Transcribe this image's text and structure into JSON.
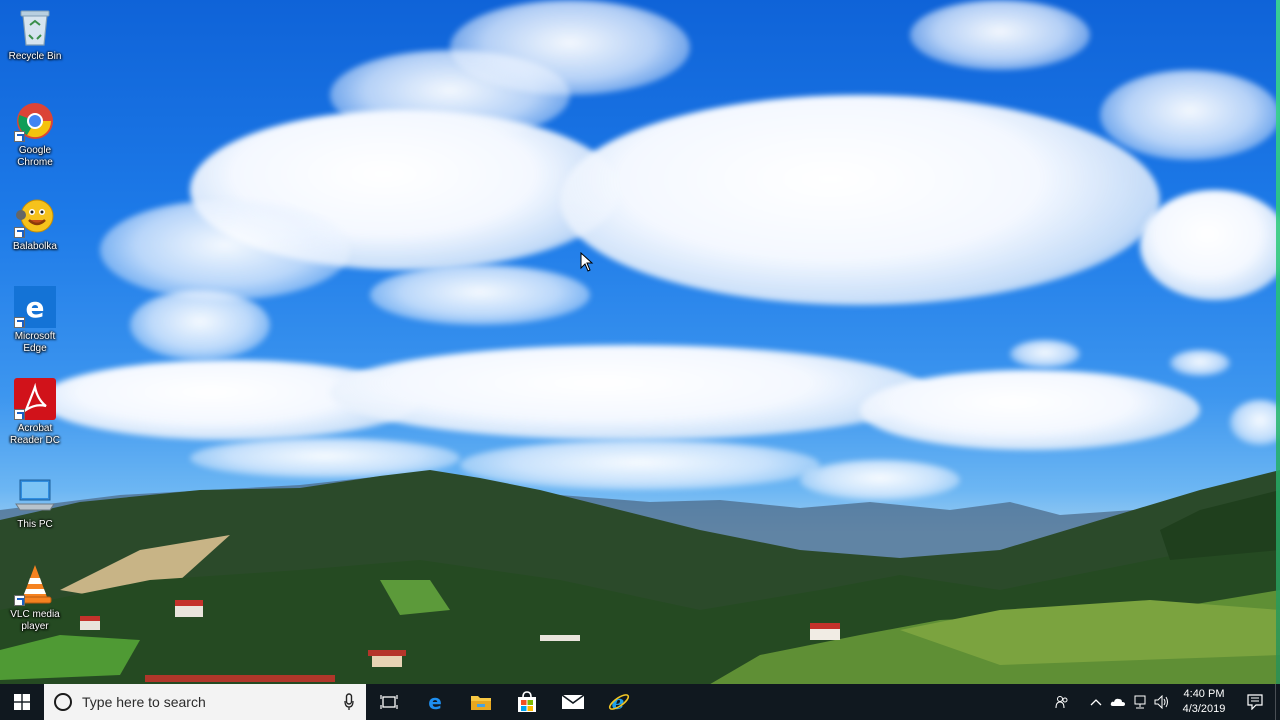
{
  "desktop": {
    "icons": [
      {
        "label": "Recycle Bin",
        "icon": "recycle-bin-icon"
      },
      {
        "label": "Google Chrome",
        "icon": "chrome-icon"
      },
      {
        "label": "Balabolka",
        "icon": "balabolka-icon"
      },
      {
        "label": "Microsoft Edge",
        "icon": "edge-icon"
      },
      {
        "label": "Acrobat Reader DC",
        "icon": "acrobat-icon"
      },
      {
        "label": "This PC",
        "icon": "this-pc-icon"
      },
      {
        "label": "VLC media player",
        "icon": "vlc-icon"
      }
    ]
  },
  "taskbar": {
    "search_placeholder": "Type here to search",
    "pinned": [
      "task-view-icon",
      "edge-icon",
      "file-explorer-icon",
      "store-icon",
      "mail-icon",
      "internet-explorer-icon"
    ],
    "tray_icons": [
      "people-icon",
      "chevron-up-icon",
      "onedrive-icon",
      "network-icon",
      "volume-icon"
    ],
    "clock": {
      "time": "4:40 PM",
      "date": "4/3/2019"
    },
    "notification_icon": "action-center-icon"
  },
  "colors": {
    "taskbar_bg": "#10181f",
    "search_bg": "#f3f3f3",
    "sky_top": "#0f63d8",
    "accent": "#0078d7"
  }
}
